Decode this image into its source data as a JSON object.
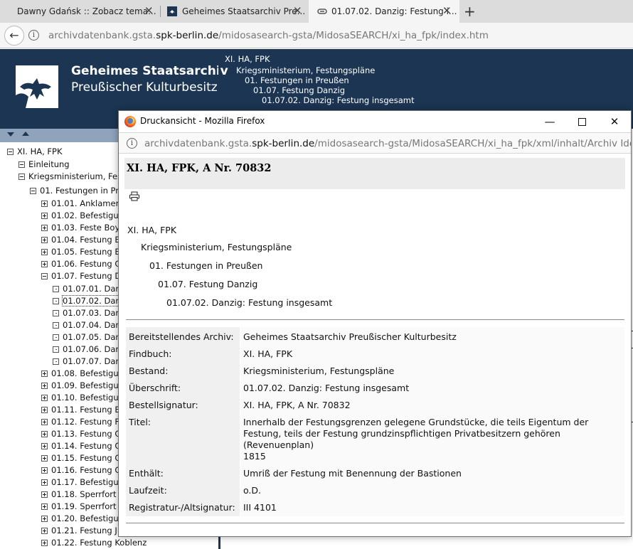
{
  "browser": {
    "tabs": [
      {
        "title": "Dawny Gdańsk :: Zobacz tema..."
      },
      {
        "title": "Geheimes Staatsarchiv Pre..."
      },
      {
        "title": "01.07.02. Danzig: Festung i..."
      }
    ],
    "new_tab_label": "+",
    "close_label": "✕",
    "url_host": "archivdatenbank.gsta.spk-berlin.de",
    "url_prefix": "archivdatenbank.gsta.",
    "url_host_bold": "spk-berlin.de",
    "url_path": "/midosasearch-gsta/MidosaSEARCH/xi_ha_fpk/index.htm"
  },
  "site": {
    "org_line1": "Geheimes Staatsarchiv",
    "org_line2": "Preußischer Kulturbesitz",
    "brand_color": "#1b3553",
    "breadcrumb": [
      "XI. HA, FPK",
      "Kriegsministerium, Festungspläne",
      "01. Festungen in Preußen",
      "01.07. Festung Danzig",
      "01.07.02. Danzig: Festung insgesamt"
    ]
  },
  "tree": [
    {
      "label": "XI. HA, FPK",
      "state": "minus"
    },
    {
      "label": "Einleitung",
      "state": "minus"
    },
    {
      "label": "Kriegsministerium, Fes",
      "state": "minus"
    },
    {
      "label": "01. Festungen in Pr",
      "state": "minus"
    },
    {
      "label": "01.01. Anklamer",
      "state": "plus"
    },
    {
      "label": "01.02. Befestigu",
      "state": "plus"
    },
    {
      "label": "01.03. Feste Boy",
      "state": "plus"
    },
    {
      "label": "01.04. Festung B",
      "state": "plus"
    },
    {
      "label": "01.05. Festung B",
      "state": "plus"
    },
    {
      "label": "01.06. Festung C",
      "state": "plus"
    },
    {
      "label": "01.07. Festung D",
      "state": "minus"
    },
    {
      "label": "01.07.01. Dar",
      "state": "dot"
    },
    {
      "label": "01.07.02. Dar",
      "state": "dot",
      "selected": true
    },
    {
      "label": "01.07.03. Dar",
      "state": "dot"
    },
    {
      "label": "01.07.04. Dar",
      "state": "dot"
    },
    {
      "label": "01.07.05. Dar",
      "state": "dot"
    },
    {
      "label": "01.07.06. Dar",
      "state": "dot"
    },
    {
      "label": "01.07.07. Dar",
      "state": "dot"
    },
    {
      "label": "01.08. Befestigu",
      "state": "plus"
    },
    {
      "label": "01.09. Befestigu",
      "state": "plus"
    },
    {
      "label": "01.10. Befestigu",
      "state": "plus"
    },
    {
      "label": "01.11. Festung B",
      "state": "plus"
    },
    {
      "label": "01.12. Festung F",
      "state": "plus"
    },
    {
      "label": "01.13. Festung C",
      "state": "plus"
    },
    {
      "label": "01.14. Festung C",
      "state": "plus"
    },
    {
      "label": "01.15. Festung C",
      "state": "plus"
    },
    {
      "label": "01.16. Festung C",
      "state": "plus"
    },
    {
      "label": "01.17. Befestigu",
      "state": "plus"
    },
    {
      "label": "01.18. Sperrfort",
      "state": "plus"
    },
    {
      "label": "01.19. Sperrfort",
      "state": "plus"
    },
    {
      "label": "01.20. Befestigu",
      "state": "plus"
    },
    {
      "label": "01.21. Festung J",
      "state": "plus"
    },
    {
      "label": "01.22. Festung Koblenz",
      "state": "plus"
    }
  ],
  "popup": {
    "window_title": "Druckansicht - Mozilla Firefox",
    "url_prefix": "archivdatenbank.gsta.",
    "url_host_bold": "spk-berlin.de",
    "url_path": "/midosasearch-gsta/MidosaSEARCH/xi_ha_fpk/xml/inhalt/Archiv Identifikatio",
    "doc_title": "XI. HA, FPK, A Nr. 70832",
    "print_icon": "printer-icon",
    "hierarchy": [
      "XI. HA, FPK",
      "Kriegsministerium, Festungspläne",
      "01. Festungen in Preußen",
      "01.07. Festung Danzig",
      "01.07.02. Danzig: Festung insgesamt"
    ],
    "metadata": [
      {
        "label": "Bereitstellendes Archiv:",
        "value": [
          "Geheimes Staatsarchiv Preußischer Kulturbesitz"
        ]
      },
      {
        "label": "Findbuch:",
        "value": [
          "XI. HA, FPK"
        ]
      },
      {
        "label": "Bestand:",
        "value": [
          "Kriegsministerium, Festungspläne"
        ]
      },
      {
        "label": "Überschrift:",
        "value": [
          "01.07.02. Danzig: Festung insgesamt"
        ]
      },
      {
        "label": "Bestellsignatur:",
        "value": [
          "XI. HA, FPK, A Nr. 70832"
        ]
      },
      {
        "label": "Titel:",
        "value": [
          "Innerhalb der Festungsgrenzen gelegene Grundstücke, die teils Eigentum der",
          "Festung, teils der Festung grundzinspflichtigen Privatbesitzern gehören",
          "(Revenuenplan)",
          "1815"
        ]
      },
      {
        "label": "Enthält:",
        "value": [
          "Umriß der Festung mit Benennung der Bastionen"
        ]
      },
      {
        "label": "Laufzeit:",
        "value": [
          "o.D."
        ]
      },
      {
        "label": "Registratur-/Altsignatur:",
        "value": [
          "III 4101"
        ]
      }
    ]
  }
}
